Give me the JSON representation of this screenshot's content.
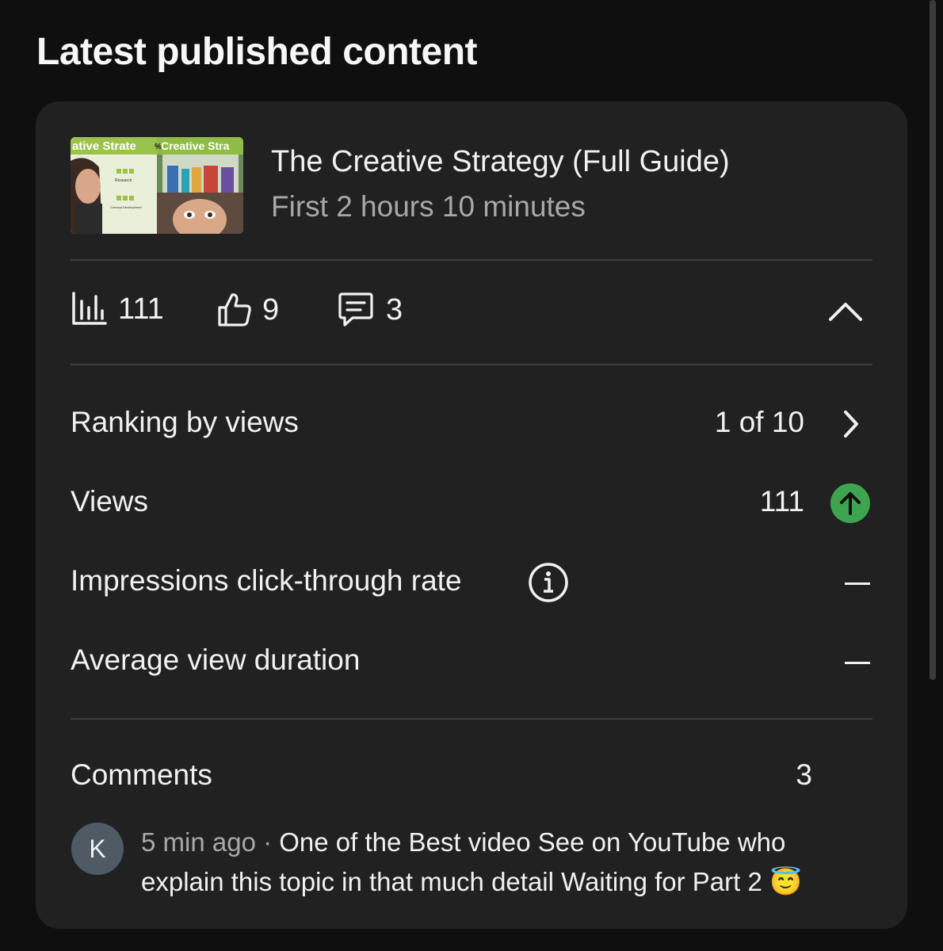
{
  "header": {
    "title": "Latest published content"
  },
  "video": {
    "title": "The Creative Strategy (Full Guide)",
    "subtitle": "First 2 hours 10 minutes",
    "thumbnail": {
      "left_text": "ative Strate",
      "right_text": "Creative Stra",
      "percent": "%",
      "label_research": "Research",
      "label_concept": "Concept Development"
    }
  },
  "stats": {
    "views": "111",
    "likes": "9",
    "comments": "3"
  },
  "metrics": [
    {
      "label": "Ranking by views",
      "value": "1 of 10"
    },
    {
      "label": "Views",
      "value": "111"
    },
    {
      "label": "Impressions click-through rate",
      "value": "—"
    },
    {
      "label": "Average view duration",
      "value": "—"
    }
  ],
  "comments_section": {
    "label": "Comments",
    "count": "3",
    "items": [
      {
        "avatar_letter": "K",
        "time": "5 min ago",
        "separator": " · ",
        "text": "One of the Best video See on YouTube who explain this topic in that much detail Waiting for Part 2",
        "emoji": "😇"
      }
    ]
  },
  "colors": {
    "background": "#0f0f0f",
    "card": "#212121",
    "accent_green": "#3ea44f",
    "muted_text": "#a8a8a8"
  },
  "icons": [
    "bar-chart-icon",
    "thumbs-up-icon",
    "comment-icon",
    "chevron-up-icon",
    "chevron-right-icon",
    "arrow-up-icon",
    "info-icon"
  ]
}
